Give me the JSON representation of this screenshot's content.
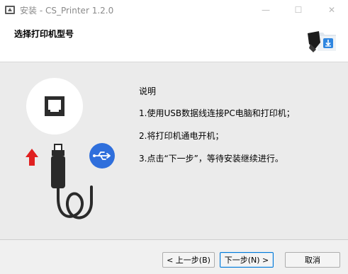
{
  "titlebar": {
    "title": "安装 - CS_Printer 1.2.0",
    "minimize_glyph": "—",
    "maximize_glyph": "☐",
    "close_glyph": "✕"
  },
  "header": {
    "title": "选择打印机型号",
    "icon": "printer-download-icon"
  },
  "content": {
    "instructions_title": "说明",
    "lines": [
      "1.使用USB数据线连接PC电脑和打印机；",
      "2.将打印机通电开机；",
      "3.点击“下一步”，等待安装继续进行。"
    ],
    "illustration_icons": [
      "printer-icon",
      "usb-icon",
      "arrow-up-icon",
      "usb-cable-icon"
    ],
    "colors": {
      "accent_blue": "#2f6fdc",
      "arrow_red": "#e02020",
      "cable_dark": "#2a2a2a",
      "printer_dark": "#2c2c2c"
    }
  },
  "footer": {
    "back_label": "< 上一步(B)",
    "next_label": "下一步(N) >",
    "cancel_label": "取消"
  }
}
